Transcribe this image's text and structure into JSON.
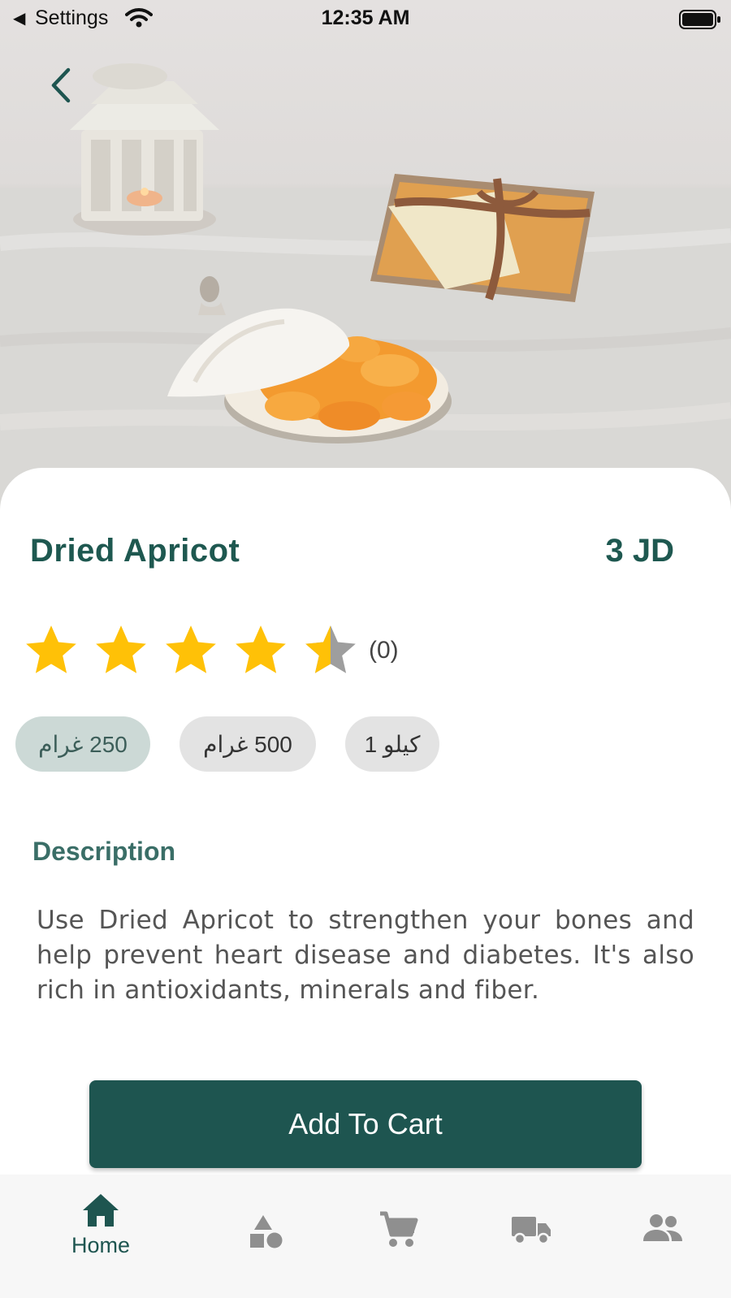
{
  "status_bar": {
    "back_app": "Settings",
    "back_glyph": "◀",
    "time": "12:35 AM",
    "icons": [
      "wifi-icon",
      "battery-icon"
    ]
  },
  "product": {
    "name": "Dried Apricot",
    "price": "3 JD",
    "rating_stars": 4.5,
    "rating_max": 5,
    "rating_count": "(0)",
    "sizes": [
      {
        "label": "250 غرام",
        "selected": true
      },
      {
        "label": "500 غرام",
        "selected": false
      },
      {
        "label": "كيلو 1",
        "selected": false
      }
    ],
    "description_title": "Description",
    "description": "Use Dried Apricot to strengthen your bones and help prevent heart disease and diabetes. It's also rich in antioxidants, minerals and fiber."
  },
  "actions": {
    "add_to_cart": "Add To Cart"
  },
  "tab_bar": {
    "items": [
      {
        "label": "Home",
        "icon": "home-icon",
        "active": true
      },
      {
        "label": "",
        "icon": "categories-icon",
        "active": false
      },
      {
        "label": "",
        "icon": "cart-icon",
        "active": false
      },
      {
        "label": "",
        "icon": "delivery-truck-icon",
        "active": false
      },
      {
        "label": "",
        "icon": "people-icon",
        "active": false
      }
    ]
  },
  "colors": {
    "primary": "#1e5550",
    "star": "#ffc107",
    "star_empty": "#9e9e9e",
    "chip_selected": "#ccd9d6",
    "chip": "#e3e3e3",
    "inactive_icon": "#8f8f8f"
  }
}
